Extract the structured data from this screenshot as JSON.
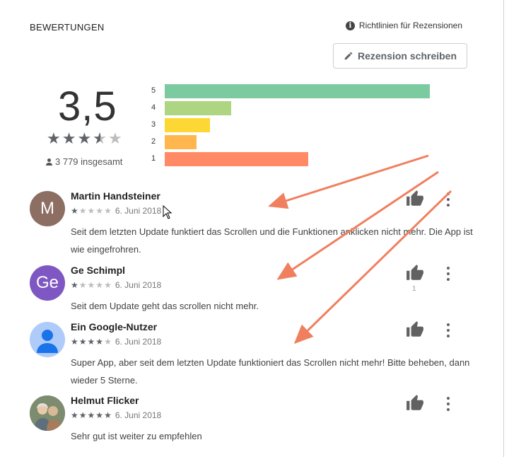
{
  "header": {
    "title": "BEWERTUNGEN",
    "policy_label": "Richtlinien für Rezensionen",
    "write_button": "Rezension schreiben"
  },
  "summary": {
    "rating": "3,5",
    "stars": 3.5,
    "total_text": "3 779 insgesamt"
  },
  "histogram": [
    {
      "label": "5",
      "fraction": 1.0,
      "color": "#7ccba0"
    },
    {
      "label": "4",
      "fraction": 0.25,
      "color": "#aed581"
    },
    {
      "label": "3",
      "fraction": 0.17,
      "color": "#fdd835"
    },
    {
      "label": "2",
      "fraction": 0.12,
      "color": "#ffb74d"
    },
    {
      "label": "1",
      "fraction": 0.54,
      "color": "#ff8a65"
    }
  ],
  "reviews": [
    {
      "name": "Martin Handsteiner",
      "avatar_letter": "M",
      "avatar_color": "#8d6e63",
      "stars": 1,
      "date": "6. Juni 2018",
      "text": "Seit dem letzten Update funktiert das Scrollen und die Funktionen anklicken nicht mehr. Die App ist wie eingefrohren.",
      "likes": ""
    },
    {
      "name": "Ge Schimpl",
      "avatar_letter": "Ge",
      "avatar_color": "#7e57c2",
      "stars": 1,
      "date": "6. Juni 2018",
      "text": "Seit dem Update geht das scrollen nicht mehr.",
      "likes": "1"
    },
    {
      "name": "Ein Google-Nutzer",
      "avatar_letter": "",
      "avatar_color": "#aecbfa",
      "stars": 4,
      "date": "6. Juni 2018",
      "text": "Super App, aber seit dem letzten Update funktioniert das Scrollen nicht mehr! Bitte beheben, dann wieder 5 Sterne.",
      "likes": ""
    },
    {
      "name": "Helmut Flicker",
      "avatar_letter": "",
      "avatar_color": "#9e9e9e",
      "stars": 5,
      "date": "6. Juni 2018",
      "text": "Sehr gut ist weiter zu empfehlen",
      "likes": ""
    }
  ],
  "colors": {
    "annotation_arrow": "#f07f5e",
    "star_on": "#5f6368",
    "star_off": "#bdbdbd"
  }
}
